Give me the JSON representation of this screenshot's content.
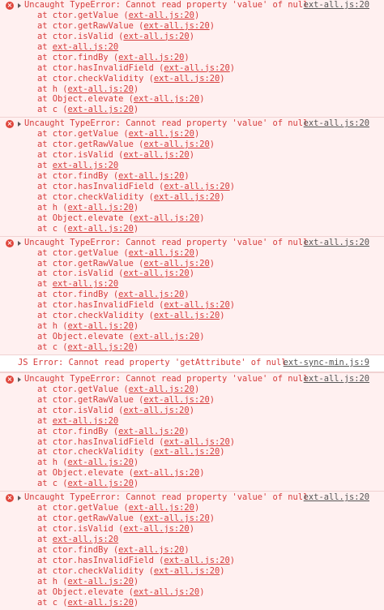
{
  "colors": {
    "error_text": "#d63c3c",
    "error_bg": "#fff0f0",
    "error_border": "#f0d2d2",
    "error_icon": "#e0463c",
    "log_text": "#303030"
  },
  "icons": {
    "error": "error-circle-x-icon",
    "expand": "expand-triangle-icon"
  },
  "entries": [
    {
      "kind": "error",
      "message": "Uncaught TypeError: Cannot read property 'value' of null",
      "source": "ext-all.js:20",
      "frames": [
        {
          "prefix": "at ctor.getValue (",
          "link": "ext-all.js:20",
          "suffix": ")"
        },
        {
          "prefix": "at ctor.getRawValue (",
          "link": "ext-all.js:20",
          "suffix": ")"
        },
        {
          "prefix": "at ctor.isValid (",
          "link": "ext-all.js:20",
          "suffix": ")"
        },
        {
          "prefix": "at ",
          "link": "ext-all.js:20",
          "suffix": ""
        },
        {
          "prefix": "at ctor.findBy (",
          "link": "ext-all.js:20",
          "suffix": ")"
        },
        {
          "prefix": "at ctor.hasInvalidField (",
          "link": "ext-all.js:20",
          "suffix": ")"
        },
        {
          "prefix": "at ctor.checkValidity (",
          "link": "ext-all.js:20",
          "suffix": ")"
        },
        {
          "prefix": "at h (",
          "link": "ext-all.js:20",
          "suffix": ")"
        },
        {
          "prefix": "at Object.elevate (",
          "link": "ext-all.js:20",
          "suffix": ")"
        },
        {
          "prefix": "at c (",
          "link": "ext-all.js:20",
          "suffix": ")"
        }
      ]
    },
    {
      "kind": "error",
      "message": "Uncaught TypeError: Cannot read property 'value' of null",
      "source": "ext-all.js:20",
      "frames": [
        {
          "prefix": "at ctor.getValue (",
          "link": "ext-all.js:20",
          "suffix": ")"
        },
        {
          "prefix": "at ctor.getRawValue (",
          "link": "ext-all.js:20",
          "suffix": ")"
        },
        {
          "prefix": "at ctor.isValid (",
          "link": "ext-all.js:20",
          "suffix": ")"
        },
        {
          "prefix": "at ",
          "link": "ext-all.js:20",
          "suffix": ""
        },
        {
          "prefix": "at ctor.findBy (",
          "link": "ext-all.js:20",
          "suffix": ")"
        },
        {
          "prefix": "at ctor.hasInvalidField (",
          "link": "ext-all.js:20",
          "suffix": ")"
        },
        {
          "prefix": "at ctor.checkValidity (",
          "link": "ext-all.js:20",
          "suffix": ")"
        },
        {
          "prefix": "at h (",
          "link": "ext-all.js:20",
          "suffix": ")"
        },
        {
          "prefix": "at Object.elevate (",
          "link": "ext-all.js:20",
          "suffix": ")"
        },
        {
          "prefix": "at c (",
          "link": "ext-all.js:20",
          "suffix": ")"
        }
      ]
    },
    {
      "kind": "error",
      "message": "Uncaught TypeError: Cannot read property 'value' of null",
      "source": "ext-all.js:20",
      "frames": [
        {
          "prefix": "at ctor.getValue (",
          "link": "ext-all.js:20",
          "suffix": ")"
        },
        {
          "prefix": "at ctor.getRawValue (",
          "link": "ext-all.js:20",
          "suffix": ")"
        },
        {
          "prefix": "at ctor.isValid (",
          "link": "ext-all.js:20",
          "suffix": ")"
        },
        {
          "prefix": "at ",
          "link": "ext-all.js:20",
          "suffix": ""
        },
        {
          "prefix": "at ctor.findBy (",
          "link": "ext-all.js:20",
          "suffix": ")"
        },
        {
          "prefix": "at ctor.hasInvalidField (",
          "link": "ext-all.js:20",
          "suffix": ")"
        },
        {
          "prefix": "at ctor.checkValidity (",
          "link": "ext-all.js:20",
          "suffix": ")"
        },
        {
          "prefix": "at h (",
          "link": "ext-all.js:20",
          "suffix": ")"
        },
        {
          "prefix": "at Object.elevate (",
          "link": "ext-all.js:20",
          "suffix": ")"
        },
        {
          "prefix": "at c (",
          "link": "ext-all.js:20",
          "suffix": ")"
        }
      ]
    },
    {
      "kind": "log",
      "message": "JS Error: Cannot read property 'getAttribute' of null",
      "source": "ext-sync-min.js:9",
      "frames": []
    },
    {
      "kind": "error",
      "message": "Uncaught TypeError: Cannot read property 'value' of null",
      "source": "ext-all.js:20",
      "frames": [
        {
          "prefix": "at ctor.getValue (",
          "link": "ext-all.js:20",
          "suffix": ")"
        },
        {
          "prefix": "at ctor.getRawValue (",
          "link": "ext-all.js:20",
          "suffix": ")"
        },
        {
          "prefix": "at ctor.isValid (",
          "link": "ext-all.js:20",
          "suffix": ")"
        },
        {
          "prefix": "at ",
          "link": "ext-all.js:20",
          "suffix": ""
        },
        {
          "prefix": "at ctor.findBy (",
          "link": "ext-all.js:20",
          "suffix": ")"
        },
        {
          "prefix": "at ctor.hasInvalidField (",
          "link": "ext-all.js:20",
          "suffix": ")"
        },
        {
          "prefix": "at ctor.checkValidity (",
          "link": "ext-all.js:20",
          "suffix": ")"
        },
        {
          "prefix": "at h (",
          "link": "ext-all.js:20",
          "suffix": ")"
        },
        {
          "prefix": "at Object.elevate (",
          "link": "ext-all.js:20",
          "suffix": ")"
        },
        {
          "prefix": "at c (",
          "link": "ext-all.js:20",
          "suffix": ")"
        }
      ]
    },
    {
      "kind": "error",
      "message": "Uncaught TypeError: Cannot read property 'value' of null",
      "source": "ext-all.js:20",
      "frames": [
        {
          "prefix": "at ctor.getValue (",
          "link": "ext-all.js:20",
          "suffix": ")"
        },
        {
          "prefix": "at ctor.getRawValue (",
          "link": "ext-all.js:20",
          "suffix": ")"
        },
        {
          "prefix": "at ctor.isValid (",
          "link": "ext-all.js:20",
          "suffix": ")"
        },
        {
          "prefix": "at ",
          "link": "ext-all.js:20",
          "suffix": ""
        },
        {
          "prefix": "at ctor.findBy (",
          "link": "ext-all.js:20",
          "suffix": ")"
        },
        {
          "prefix": "at ctor.hasInvalidField (",
          "link": "ext-all.js:20",
          "suffix": ")"
        },
        {
          "prefix": "at ctor.checkValidity (",
          "link": "ext-all.js:20",
          "suffix": ")"
        },
        {
          "prefix": "at h (",
          "link": "ext-all.js:20",
          "suffix": ")"
        },
        {
          "prefix": "at Object.elevate (",
          "link": "ext-all.js:20",
          "suffix": ")"
        },
        {
          "prefix": "at c (",
          "link": "ext-all.js:20",
          "suffix": ")"
        }
      ]
    }
  ]
}
